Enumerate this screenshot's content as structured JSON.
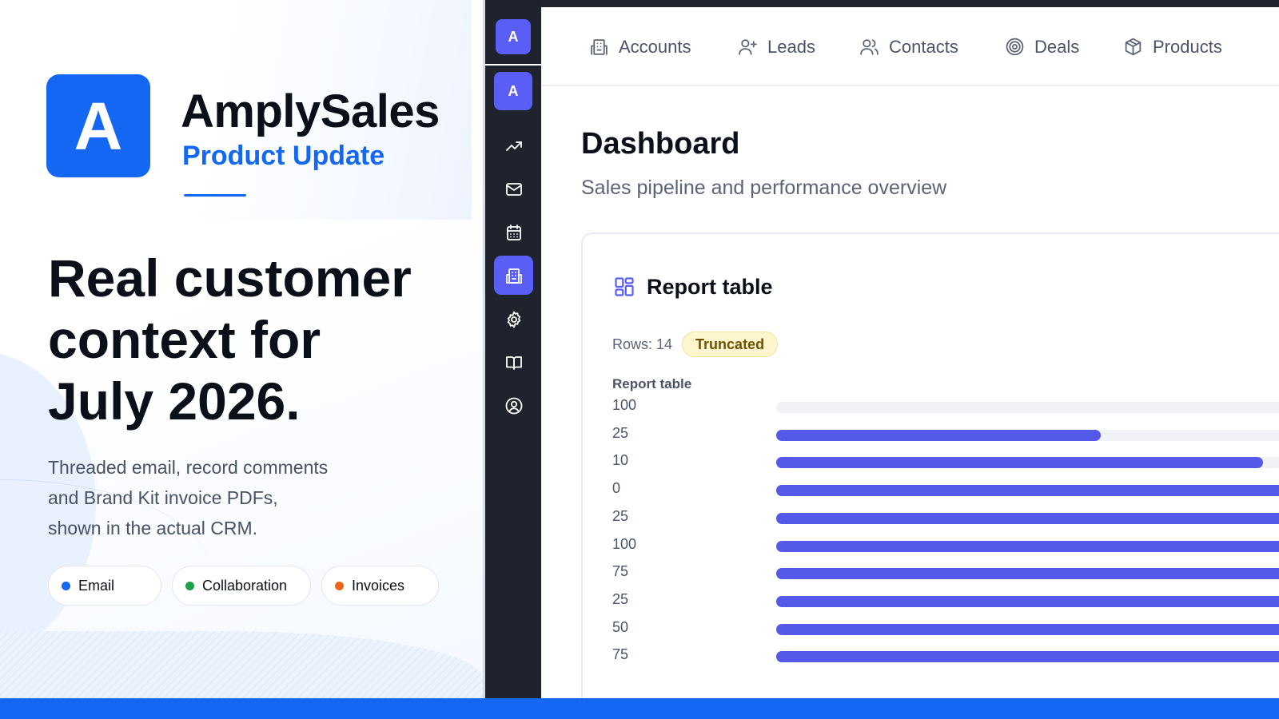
{
  "promo": {
    "logo_letter": "A",
    "brand_name": "AmplySales",
    "brand_subtitle": "Product Update",
    "headline_lines": [
      "Real customer",
      "context for",
      "July 2026."
    ],
    "description_lines": [
      "Threaded email, record comments",
      "and Brand Kit invoice PDFs,",
      "shown in the actual CRM."
    ],
    "chips": [
      {
        "label": "Email",
        "color": "#1467f2"
      },
      {
        "label": "Collaboration",
        "color": "#1ea04a"
      },
      {
        "label": "Invoices",
        "color": "#f06418"
      }
    ]
  },
  "sidebar": {
    "workspace_letter": "A",
    "app_letter": "A",
    "items": [
      {
        "icon": "trending-up-icon",
        "active": false
      },
      {
        "icon": "mail-icon",
        "active": false
      },
      {
        "icon": "calendar-icon",
        "active": false
      },
      {
        "icon": "building-icon",
        "active": true
      },
      {
        "icon": "gear-icon",
        "active": false
      },
      {
        "icon": "book-icon",
        "active": false
      },
      {
        "icon": "user-circle-icon",
        "active": false
      }
    ]
  },
  "topnav": {
    "items": [
      {
        "label": "Accounts",
        "icon": "building-icon"
      },
      {
        "label": "Leads",
        "icon": "user-plus-icon"
      },
      {
        "label": "Contacts",
        "icon": "users-icon"
      },
      {
        "label": "Deals",
        "icon": "target-icon"
      },
      {
        "label": "Products",
        "icon": "box-icon"
      }
    ]
  },
  "page": {
    "title": "Dashboard",
    "subtitle": "Sales pipeline and performance overview"
  },
  "report": {
    "title": "Report table",
    "rows_label": "Rows: 14",
    "badge": "Truncated",
    "table_label": "Report table",
    "accent_color": "#5459ea"
  },
  "chart_data": {
    "type": "bar",
    "categories": [
      "100",
      "25",
      "10",
      "0",
      "25",
      "100",
      "75",
      "25",
      "50",
      "75"
    ],
    "values": [
      0,
      0.58,
      0.87,
      1,
      1,
      1,
      1,
      1,
      1,
      1
    ]
  }
}
